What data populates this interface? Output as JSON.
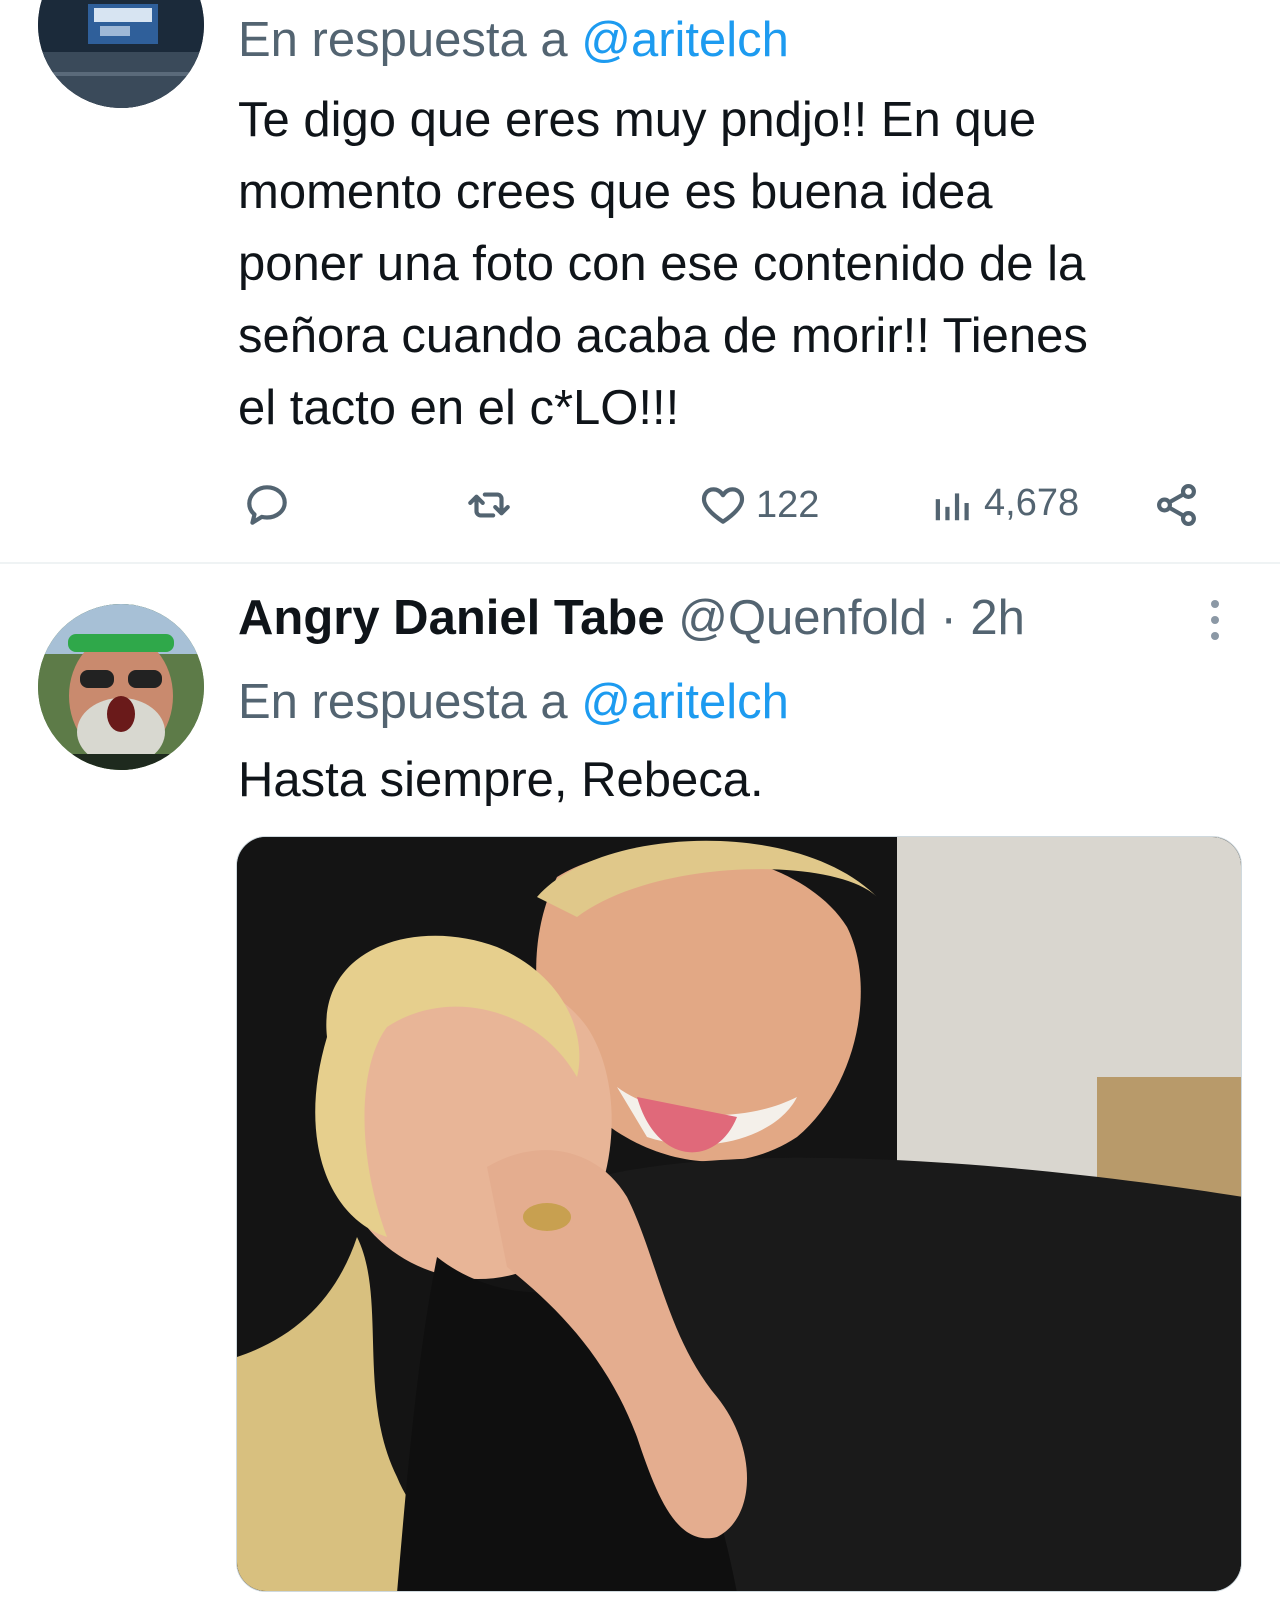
{
  "tweets": [
    {
      "avatar_icon": "stadium-avatar",
      "reply_to": {
        "prefix": "En respuesta a ",
        "mention": "@aritelch"
      },
      "text_lines": [
        "Te digo que eres muy pndjo!! En que",
        "momento crees que es buena idea",
        "poner una foto con ese contenido de la",
        "señora cuando acaba de morir!! Tienes",
        "el tacto en el c*LO!!!"
      ],
      "actions": {
        "reply_icon": "reply-icon",
        "retweet_icon": "retweet-icon",
        "like_icon": "heart-icon",
        "likes": "122",
        "views_icon": "views-chart-icon",
        "views": "4,678",
        "share_icon": "share-icon"
      }
    },
    {
      "avatar_icon": "bearded-man-avatar",
      "display_name": "Angry Daniel Tabe",
      "handle": "@Quenfold",
      "separator": "·",
      "time": "2h",
      "more_icon": "more-vertical-icon",
      "reply_to": {
        "prefix": "En respuesta a ",
        "mention": "@aritelch"
      },
      "text": "Hasta siempre, Rebeca.",
      "media": {
        "type": "photo"
      }
    }
  ],
  "colors": {
    "text": "#0f1419",
    "secondary": "#536471",
    "mention": "#1d9bf0",
    "divider": "#eff3f4"
  }
}
